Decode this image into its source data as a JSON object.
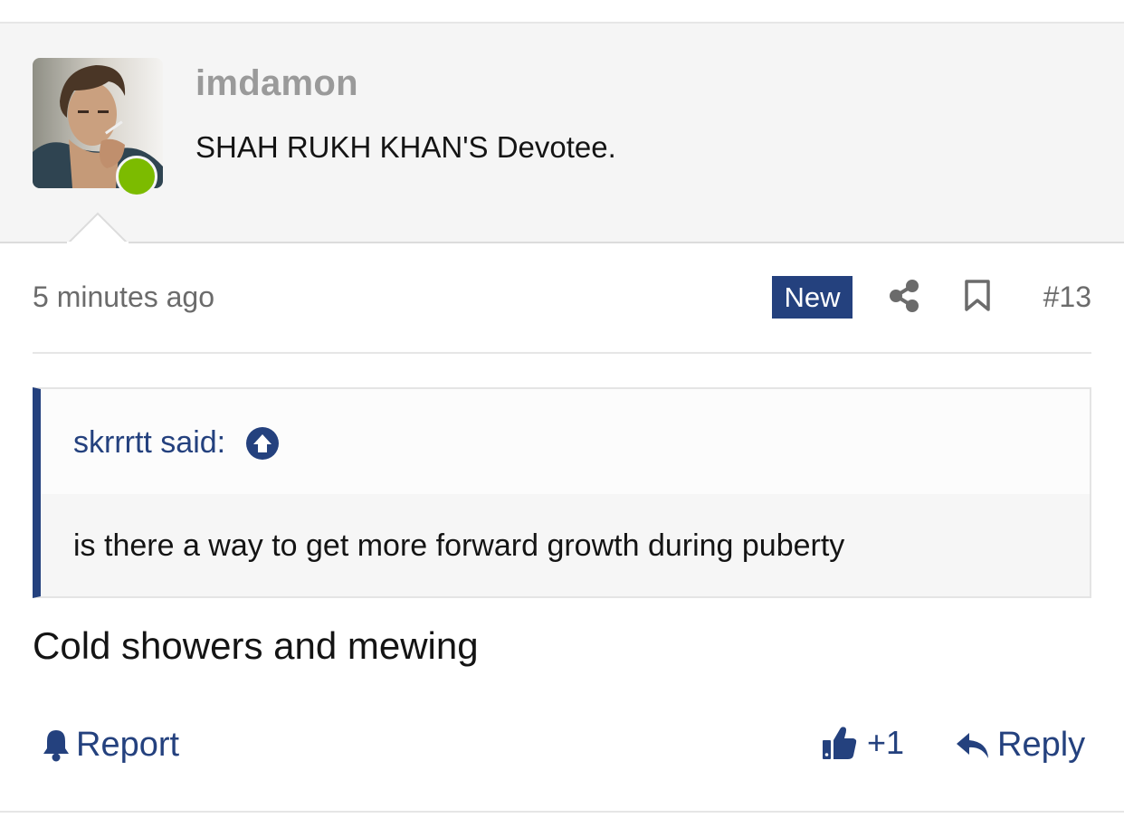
{
  "post": {
    "author": {
      "username": "imdamon",
      "title": "SHAH RUKH KHAN'S Devotee.",
      "avatar_icon": "avatar-photo",
      "status": "online",
      "status_color": "#7cbb00"
    },
    "timestamp": "5 minutes ago",
    "badge": "New",
    "badge_color": "#24417e",
    "share_icon": "share-icon",
    "bookmark_icon": "bookmark-icon",
    "number": "#13",
    "quote": {
      "author_label": "skrrrtt said:",
      "jump_icon": "arrow-up-circle-icon",
      "text": "is there a way to get more forward growth during puberty"
    },
    "body": "Cold showers and mewing",
    "actions": {
      "report_label": "Report",
      "report_icon": "bell-icon",
      "like_label": "+1",
      "like_icon": "thumbs-up-icon",
      "reply_label": "Reply",
      "reply_icon": "reply-icon"
    },
    "accent_color": "#24417e"
  }
}
